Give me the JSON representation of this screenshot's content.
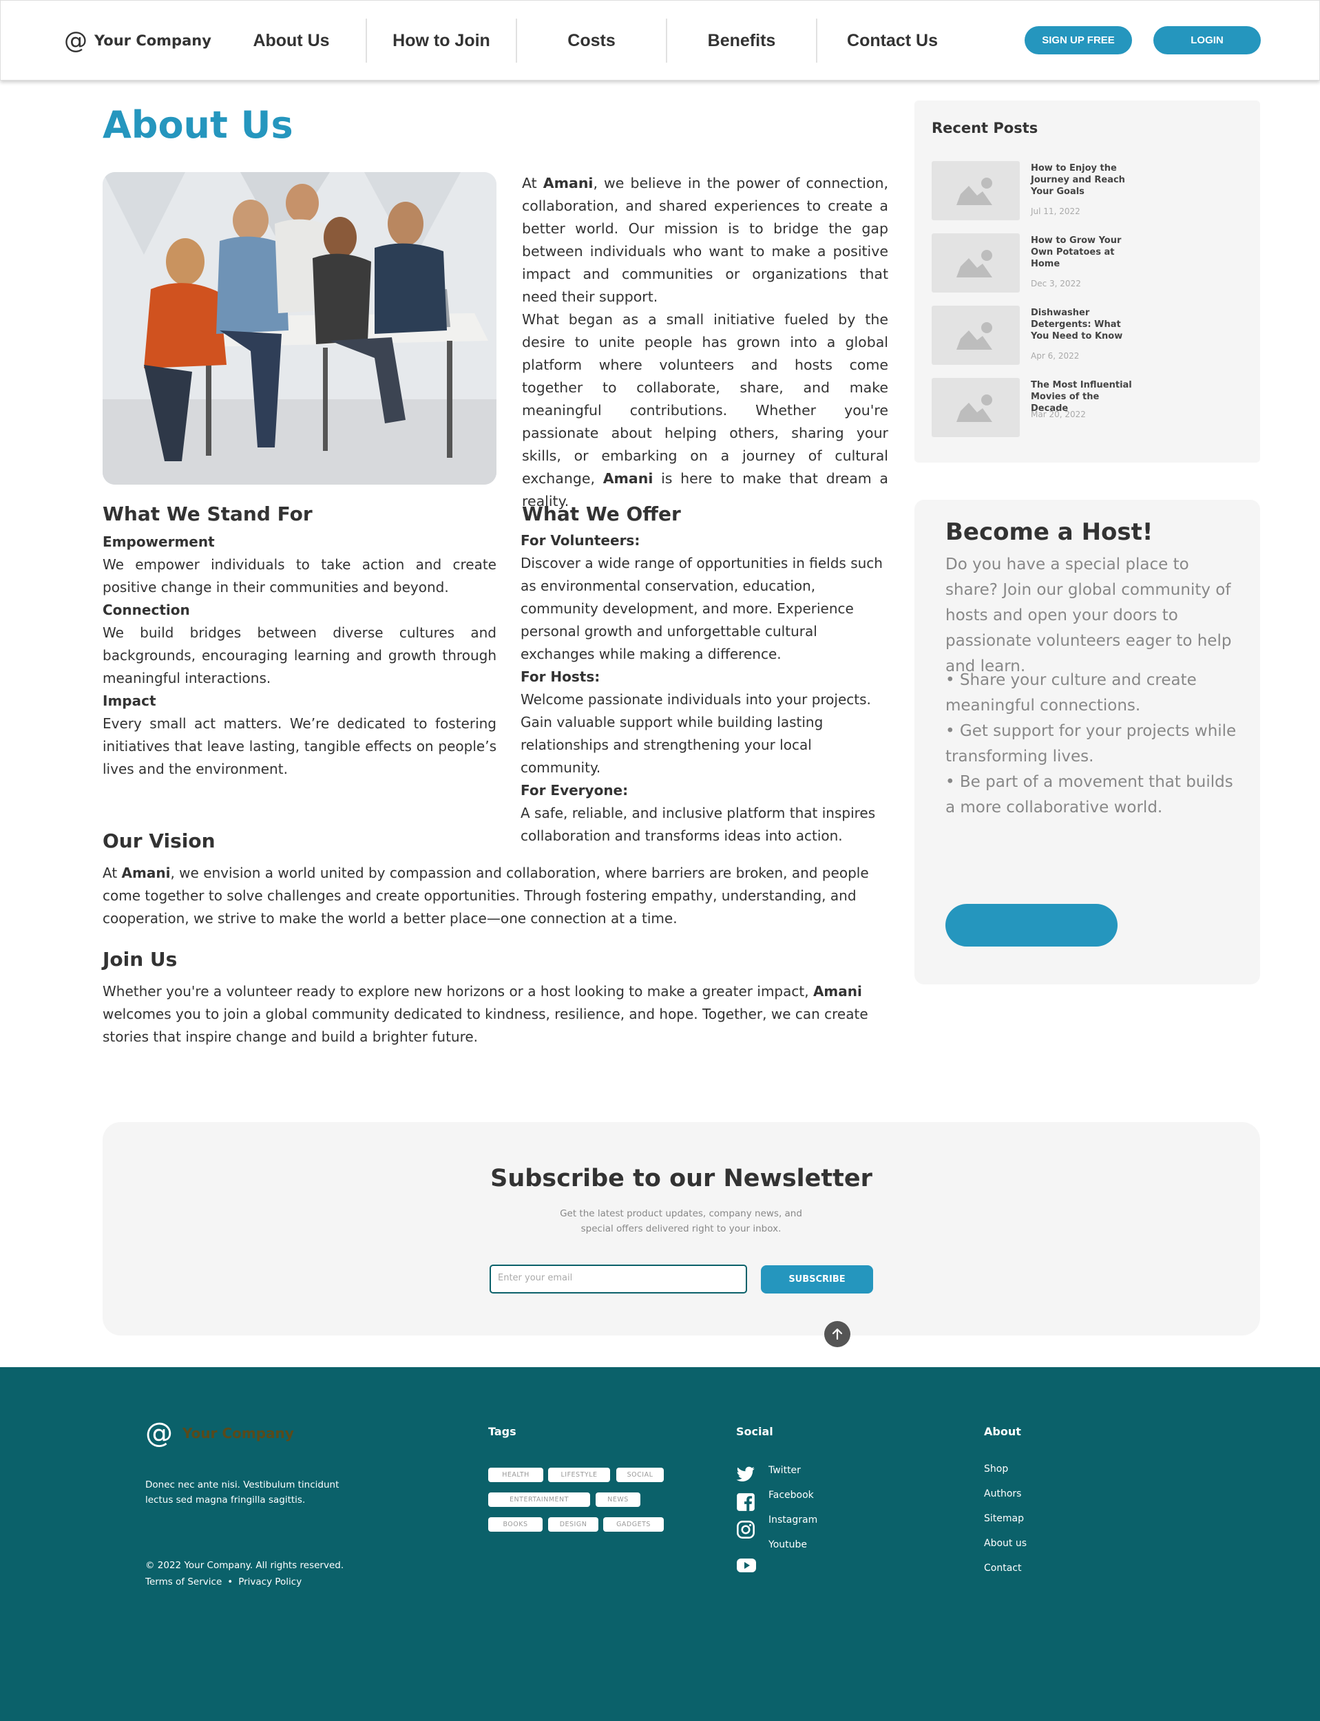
{
  "header": {
    "logo_symbol": "@",
    "company": "Your Company",
    "nav": [
      "About Us",
      "How to Join",
      "Costs",
      "Benefits",
      "Contact Us"
    ],
    "signup_label": "SIGN UP FREE",
    "login_label": "LOGIN"
  },
  "main": {
    "title": "About Us",
    "hero_image": "people-at-table-image",
    "intro": {
      "p1_pre": "At ",
      "brand": "Amani",
      "p1_post": ", we believe in the power of connection, collaboration, and shared experiences to create a better world. Our mission is to bridge the gap between individuals who want to make a positive impact and communities or organizations that need their support.",
      "p2": "What began as a small initiative fueled by the desire to unite people has grown into a global platform where volunteers and hosts come together to collaborate, share, and make meaningful contributions. Whether you're passionate about helping others, sharing your skills, or embarking on a journey of cultural exchange, ",
      "p2_post": " is here to make that dream a reality."
    },
    "stand": {
      "title": "What We Stand For",
      "items": [
        {
          "label": "Empowerment",
          "text": "We empower individuals to take action and create positive change in their communities and beyond."
        },
        {
          "label": "Connection",
          "text": "We build bridges between diverse cultures and backgrounds, encouraging learning and growth through meaningful interactions."
        },
        {
          "label": "Impact",
          "text": "Every small act matters. We’re dedicated to fostering initiatives that leave lasting, tangible effects on people’s lives and the environment."
        }
      ]
    },
    "offer": {
      "title": "What We Offer",
      "items": [
        {
          "label": "For Volunteers:",
          "text": "Discover a wide range of opportunities in fields such as environmental conservation, education, community development, and more. Experience personal growth and unforgettable cultural exchanges while making a difference."
        },
        {
          "label": "For Hosts:",
          "text": "Welcome passionate individuals into your projects. Gain valuable support while building lasting relationships and strengthening your local community."
        },
        {
          "label": "For Everyone:",
          "text": "A safe, reliable, and inclusive platform that inspires collaboration and transforms ideas into action."
        }
      ]
    },
    "vision": {
      "title": "Our Vision",
      "pre": "At ",
      "post": ", we envision a world united by compassion and collaboration, where barriers are broken, and people come together to solve challenges and create opportunities. Through fostering empathy, understanding, and cooperation, we strive to make the world a better place—one connection at a time."
    },
    "join": {
      "title": "Join Us",
      "pre": "Whether you're a volunteer ready to explore new horizons or a host looking to make a greater impact, ",
      "post": " welcomes you to join a global community dedicated to kindness, resilience, and hope. Together, we can create stories that inspire change and build a brighter future."
    }
  },
  "sidebar": {
    "recent_title": "Recent Posts",
    "posts": [
      {
        "title": "How to Enjoy the Journey and Reach Your Goals",
        "date": "Jul 11, 2022"
      },
      {
        "title": "How to Grow Your Own Potatoes at Home",
        "date": "Dec 3, 2022"
      },
      {
        "title": "Dishwasher Detergents: What You Need to Know",
        "date": "Apr 6, 2022"
      },
      {
        "title": "The Most Influential Movies of the Decade",
        "date": "Mar 20, 2022"
      }
    ],
    "host": {
      "title": "Become a Host!",
      "desc": "Do you have a special place to share? Join our global community of hosts and open your doors to passionate volunteers eager to help and learn.",
      "bullets": [
        "• Share your culture and create meaningful connections.",
        "• Get support for your projects while transforming lives.",
        "• Be part of a movement that builds a more collaborative world."
      ]
    }
  },
  "newsletter": {
    "title": "Subscribe to our Newsletter",
    "desc": "Get the latest product updates, company news, and special offers delivered right to your inbox.",
    "placeholder": "Enter your email",
    "button": "SUBSCRIBE"
  },
  "footer": {
    "logo_symbol": "@",
    "company": "Your Company",
    "desc": "Donec nec ante nisi. Vestibulum tincidunt lectus sed magna fringilla sagittis.",
    "copyright": "© 2022 Your Company.  All rights reserved.",
    "terms": "Terms of Service",
    "separator": "•",
    "privacy": "Privacy Policy",
    "tags_title": "Tags",
    "tags": [
      "HEALTH",
      "LIFESTYLE",
      "SOCIAL",
      "ENTERTAINMENT",
      "NEWS",
      "BOOKS",
      "DESIGN",
      "GADGETS"
    ],
    "social_title": "Social",
    "social": [
      "Twitter",
      "Facebook",
      "Instagram",
      "Youtube"
    ],
    "about_title": "About",
    "about": [
      "Shop",
      "Authors",
      "Sitemap",
      "About us",
      "Contact"
    ]
  },
  "colors": {
    "accent": "#2596be",
    "footer_bg": "#0b616a",
    "panel_bg": "#f5f5f5"
  }
}
